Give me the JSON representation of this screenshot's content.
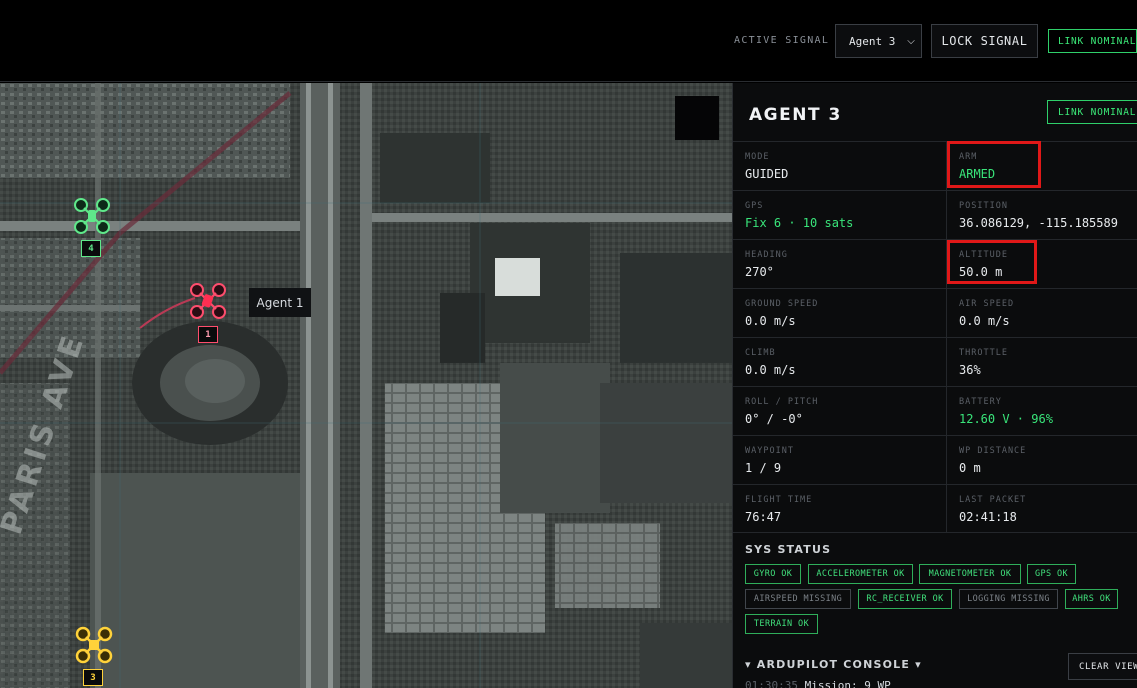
{
  "topbar": {
    "active_signal_label": "ACTIVE SIGNAL",
    "agent_select_value": "Agent 3",
    "lock_signal_label": "LOCK SIGNAL",
    "link_status": "LINK NOMINAL"
  },
  "map": {
    "drones": [
      {
        "tag": "4",
        "color": "#5fe88a"
      },
      {
        "tag": "1",
        "color": "#ff4d6d"
      },
      {
        "tag": "3",
        "color": "#ffd23a"
      }
    ],
    "tooltip": "Agent 1",
    "street_label": "PARIS AVE"
  },
  "panel": {
    "title": "AGENT 3",
    "link_status": "LINK NOMINAL",
    "telemetry": [
      {
        "key": "MODE",
        "value": "GUIDED"
      },
      {
        "key": "ARM",
        "value": "ARMED"
      },
      {
        "key": "GPS",
        "value": "Fix 6 · 10 sats"
      },
      {
        "key": "POSITION",
        "value": "36.086129, -115.185589"
      },
      {
        "key": "HEADING",
        "value": "270°"
      },
      {
        "key": "ALTITUDE",
        "value": "50.0 m"
      },
      {
        "key": "GROUND SPEED",
        "value": "0.0 m/s"
      },
      {
        "key": "AIR SPEED",
        "value": "0.0 m/s"
      },
      {
        "key": "CLIMB",
        "value": "0.0 m/s"
      },
      {
        "key": "THROTTLE",
        "value": "36%"
      },
      {
        "key": "ROLL / PITCH",
        "value": "0° / -0°"
      },
      {
        "key": "BATTERY",
        "value": "12.60 V · 96%"
      },
      {
        "key": "WAYPOINT",
        "value": "1 / 9"
      },
      {
        "key": "WP DISTANCE",
        "value": "0 m"
      },
      {
        "key": "FLIGHT TIME",
        "value": "76:47"
      },
      {
        "key": "LAST PACKET",
        "value": "02:41:18"
      }
    ],
    "sys_status_title": "SYS STATUS",
    "sys_status": [
      {
        "label": "GYRO OK",
        "ok": true
      },
      {
        "label": "ACCELEROMETER OK",
        "ok": true
      },
      {
        "label": "MAGNETOMETER OK",
        "ok": true
      },
      {
        "label": "GPS OK",
        "ok": true
      },
      {
        "label": "AIRSPEED MISSING",
        "ok": false
      },
      {
        "label": "RC_RECEIVER OK",
        "ok": true
      },
      {
        "label": "LOGGING MISSING",
        "ok": false
      },
      {
        "label": "AHRS OK",
        "ok": true
      },
      {
        "label": "TERRAIN OK",
        "ok": true
      }
    ],
    "console_title": "▾ ARDUPILOT CONSOLE ▾",
    "clear_view_label": "CLEAR VIEW",
    "console_lines": [
      {
        "time": "01:30:35",
        "text": "Mission: 9 WP"
      }
    ]
  },
  "colors": {
    "accent_green": "#39e57a",
    "highlight_red": "#e01818"
  }
}
